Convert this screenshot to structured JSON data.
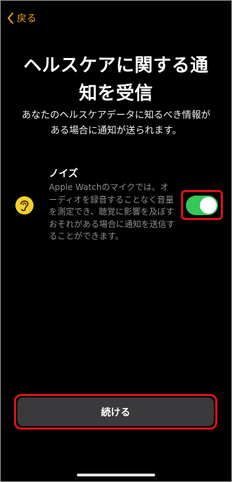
{
  "nav": {
    "back_label": "戻る"
  },
  "header": {
    "title_line1": "ヘルスケアに関する通",
    "title_line2": "知を受信",
    "subtitle_line1": "あなたのヘルスケアデータに知るべき情報が",
    "subtitle_line2": "ある場合に通知が送られます。"
  },
  "noise": {
    "title": "ノイズ",
    "description_lines": [
      "Apple Watchのマイクでは、オ",
      "ーディオを録音することなく音量",
      "を測定でき、聴覚に影響を及ぼす",
      "おそれがある場合に通知を送信す",
      "ることができます。"
    ],
    "icon": "ear-icon",
    "toggle_on": true
  },
  "footer": {
    "continue_label": "続ける"
  },
  "colors": {
    "accent": "#f0a11a",
    "toggle": "#34c759",
    "highlight": "#e0101a",
    "button": "#3a3a3c"
  }
}
